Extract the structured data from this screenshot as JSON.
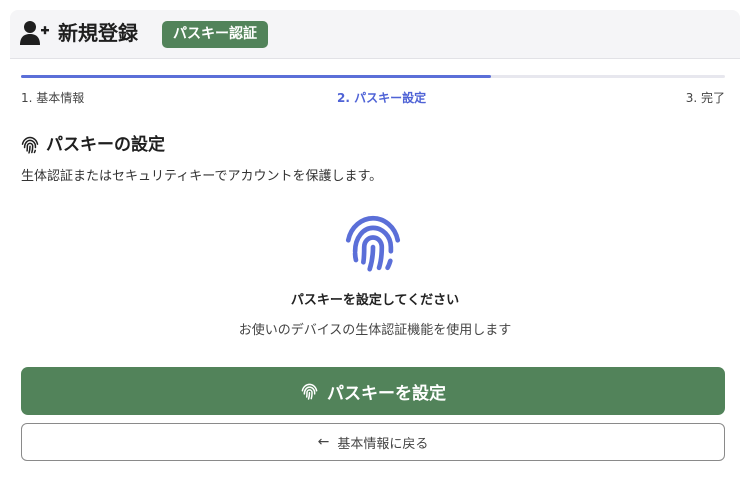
{
  "header": {
    "title": "新規登録",
    "badge": "パスキー認証",
    "icon": "user-plus-icon"
  },
  "progress": {
    "fraction": 0.667,
    "color": "#5b6fd8",
    "steps": [
      {
        "label": "1. 基本情報",
        "state": "done"
      },
      {
        "label": "2. パスキー設定",
        "state": "current"
      },
      {
        "label": "3. 完了",
        "state": "pending"
      }
    ]
  },
  "section": {
    "title": "パスキーの設定",
    "icon": "fingerprint-icon",
    "description": "生体認証またはセキュリティキーでアカウントを保護します。"
  },
  "prompt": {
    "icon": "fingerprint-icon",
    "icon_color": "#5b6fd8",
    "title": "パスキーを設定してください",
    "subtitle": "お使いのデバイスの生体認証機能を使用します"
  },
  "buttons": {
    "primary_label": "パスキーを設定",
    "primary_color": "#52835a",
    "back_label": "基本情報に戻る",
    "back_icon": "arrow-left-icon"
  }
}
